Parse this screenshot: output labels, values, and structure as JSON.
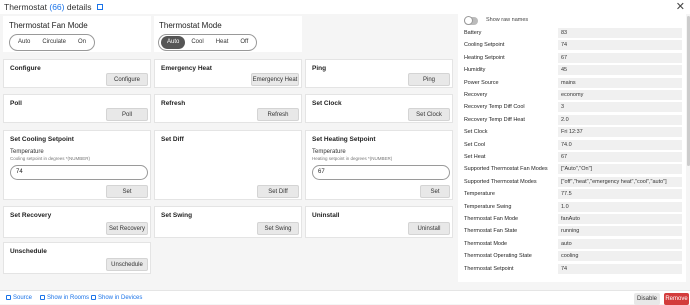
{
  "header": {
    "title": "Thermostat",
    "count": "(66)",
    "suffix": "details",
    "close": "✕"
  },
  "fan_mode": {
    "title": "Thermostat Fan Mode",
    "options": [
      "Auto",
      "Circulate",
      "On"
    ],
    "selected": ""
  },
  "thermo_mode": {
    "title": "Thermostat Mode",
    "options": [
      "Auto",
      "Cool",
      "Heat",
      "Off"
    ],
    "selected": "Auto"
  },
  "commands": {
    "configure": {
      "title": "Configure",
      "button": "Configure"
    },
    "emergency_heat": {
      "title": "Emergency Heat",
      "button": "Emergency Heat"
    },
    "ping": {
      "title": "Ping",
      "button": "Ping"
    },
    "poll": {
      "title": "Poll",
      "button": "Poll"
    },
    "refresh": {
      "title": "Refresh",
      "button": "Refresh"
    },
    "set_clock": {
      "title": "Set Clock",
      "button": "Set Clock"
    },
    "set_cooling_setpoint": {
      "title": "Set Cooling Setpoint",
      "field_label": "Temperature",
      "hint": "Cooling setpoint in degrees *(NUMBER)",
      "value": "74",
      "button": "Set"
    },
    "set_diff": {
      "title": "Set Diff",
      "button": "Set Diff"
    },
    "set_heating_setpoint": {
      "title": "Set Heating Setpoint",
      "field_label": "Temperature",
      "hint": "Heating setpoint in degrees *(NUMBER)",
      "value": "67",
      "button": "Set"
    },
    "set_recovery": {
      "title": "Set Recovery",
      "button": "Set Recovery"
    },
    "set_swing": {
      "title": "Set Swing",
      "button": "Set Swing"
    },
    "uninstall": {
      "title": "Uninstall",
      "button": "Uninstall"
    },
    "unschedule": {
      "title": "Unschedule",
      "button": "Unschedule"
    }
  },
  "attributes_panel": {
    "toggle_label": "Show raw names",
    "items": [
      {
        "name": "Battery",
        "value": "83"
      },
      {
        "name": "Cooling Setpoint",
        "value": "74"
      },
      {
        "name": "Heating Setpoint",
        "value": "67"
      },
      {
        "name": "Humidity",
        "value": "45"
      },
      {
        "name": "Power Source",
        "value": "mains"
      },
      {
        "name": "Recovery",
        "value": "economy"
      },
      {
        "name": "Recovery Temp Diff Cool",
        "value": "3"
      },
      {
        "name": "Recovery Temp Diff Heat",
        "value": "2.0"
      },
      {
        "name": "Set Clock",
        "value": "Fri 12:37"
      },
      {
        "name": "Set Cool",
        "value": "74.0"
      },
      {
        "name": "Set Heat",
        "value": "67"
      },
      {
        "name": "Supported Thermostat Fan Modes",
        "value": "[\"Auto\",\"On\"]"
      },
      {
        "name": "Supported Thermostat Modes",
        "value": "[\"off\",\"heat\",\"emergency heat\",\"cool\",\"auto\"]"
      },
      {
        "name": "Temperature",
        "value": "77.5"
      },
      {
        "name": "Temperature Swing",
        "value": "1.0"
      },
      {
        "name": "Thermostat Fan Mode",
        "value": "fanAuto"
      },
      {
        "name": "Thermostat Fan State",
        "value": "running"
      },
      {
        "name": "Thermostat Mode",
        "value": "auto"
      },
      {
        "name": "Thermostat Operating State",
        "value": "cooling"
      },
      {
        "name": "Thermostat Setpoint",
        "value": "74"
      }
    ]
  },
  "footer": {
    "source": "Source",
    "show_in_rooms": "Show in Rooms",
    "show_in_devices": "Show in Devices",
    "disable": "Disable",
    "remove": "Remove"
  },
  "colors": {
    "accent": "#1a73e8",
    "remove": "#d33c3c",
    "selected_segment": "#555555"
  }
}
